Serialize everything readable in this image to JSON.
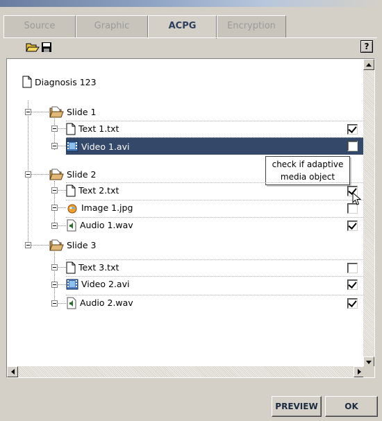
{
  "tabs": [
    {
      "label": "Source",
      "active": false
    },
    {
      "label": "Graphic",
      "active": false
    },
    {
      "label": "ACPG",
      "active": true
    },
    {
      "label": "Encryption",
      "active": false
    }
  ],
  "toolbar": {
    "open_icon": "open-folder-icon",
    "save_icon": "floppy-disk-icon",
    "help_label": "?"
  },
  "tree": {
    "root": "Diagnosis 123",
    "slides": [
      {
        "label": "Slide 1",
        "items": [
          {
            "label": "Text 1.txt",
            "icon": "document-icon",
            "checked": true,
            "selected": false
          },
          {
            "label": "Video 1.avi",
            "icon": "video-file-icon",
            "checked": false,
            "selected": true
          }
        ]
      },
      {
        "label": "Slide 2",
        "items": [
          {
            "label": "Text 2.txt",
            "icon": "document-icon",
            "checked": true,
            "selected": false
          },
          {
            "label": "Image 1.jpg",
            "icon": "image-file-icon",
            "checked": false,
            "selected": false
          },
          {
            "label": "Audio 1.wav",
            "icon": "audio-file-icon",
            "checked": true,
            "selected": false
          }
        ]
      },
      {
        "label": "Slide 3",
        "items": [
          {
            "label": "Text 3.txt",
            "icon": "document-icon",
            "checked": false,
            "selected": false
          },
          {
            "label": "Video 2.avi",
            "icon": "video-file-icon",
            "checked": true,
            "selected": false
          },
          {
            "label": "Audio 2.wav",
            "icon": "audio-file-icon",
            "checked": true,
            "selected": false
          }
        ]
      }
    ]
  },
  "tooltip": {
    "line1": "check if adaptive",
    "line2": "media object"
  },
  "buttons": {
    "preview": "PREVIEW",
    "ok": "OK"
  },
  "colors": {
    "selection": "#34496a",
    "active_tab_text": "#2c3e5c"
  }
}
